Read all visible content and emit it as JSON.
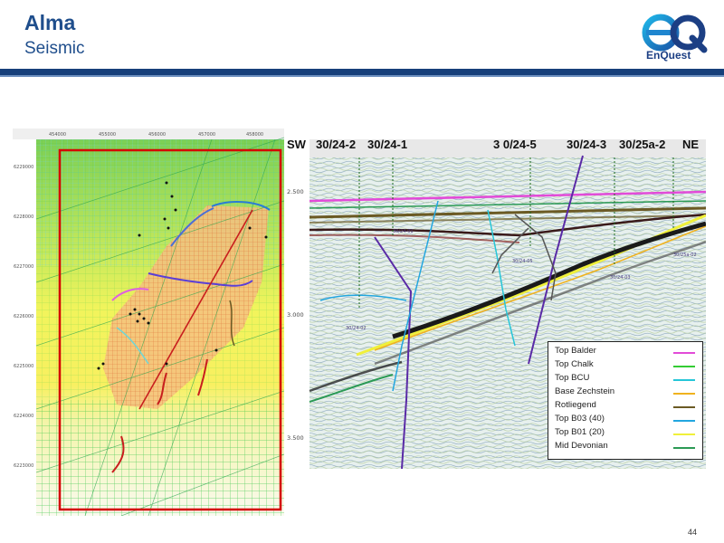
{
  "header": {
    "title": "Alma",
    "subtitle": "Seismic",
    "logo_text": "EnQuest",
    "logo_letters": "eQ"
  },
  "map": {
    "x_ticks": [
      "454000",
      "455000",
      "456000",
      "457000",
      "458000"
    ],
    "y_ticks": [
      "6229000",
      "6228000",
      "6227000",
      "6226000",
      "6225000",
      "6224000",
      "6223000"
    ],
    "colors": {
      "frame": "#d40000",
      "fault": "#c81e1e",
      "grid_green": "#3cc84b",
      "grid_cyan": "#6fd6d6"
    }
  },
  "seismic": {
    "sw_label": "SW",
    "ne_label": "NE",
    "wells": [
      "30/24-2",
      "30/24-1",
      "3 0/24-5",
      "30/24-3",
      "30/25a-2"
    ],
    "depth_ticks": [
      "2.500",
      "3.000",
      "3.500"
    ],
    "small_well_labels": [
      "30/24-01",
      "30/24-05",
      "30/24-02",
      "30/24-03",
      "30/25a-02"
    ]
  },
  "legend": {
    "items": [
      {
        "label": "Top Balder",
        "color": "#e24bd8"
      },
      {
        "label": "Top Chalk",
        "color": "#33cc33"
      },
      {
        "label": "Top BCU",
        "color": "#26c6d8"
      },
      {
        "label": "Base Zechstein",
        "color": "#f0b21e"
      },
      {
        "label": "Rotliegend",
        "color": "#6b5a24"
      },
      {
        "label": "Top B03 (40)",
        "color": "#22a6df"
      },
      {
        "label": "Top B01 (20)",
        "color": "#f0f03a"
      },
      {
        "label": "Mid Devonian",
        "color": "#2b9a55"
      }
    ]
  },
  "footer": {
    "page_number": "44"
  }
}
